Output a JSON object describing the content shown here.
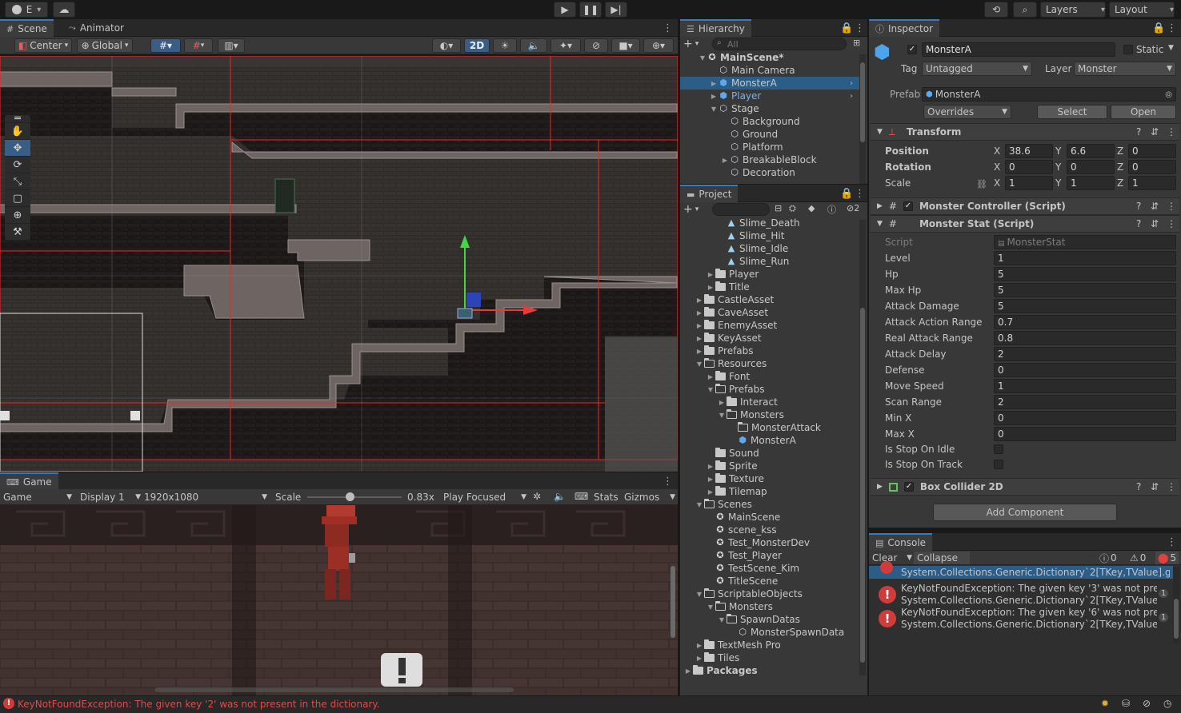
{
  "topbar": {
    "account": "E",
    "layers": "Layers",
    "layout": "Layout"
  },
  "scene": {
    "tabs": [
      {
        "label": "Scene"
      },
      {
        "label": "Animator"
      }
    ],
    "pivot": "Center",
    "space": "Global",
    "mode_2d": "2D"
  },
  "game": {
    "tab": "Game",
    "view": "Game",
    "display": "Display 1",
    "resolution": "1920x1080",
    "scale_label": "Scale",
    "scale_value": "0.83x",
    "scale_fraction": 0.45,
    "play_mode": "Play Focused",
    "stats": "Stats",
    "gizmos": "Gizmos"
  },
  "hierarchy": {
    "tab": "Hierarchy",
    "search_placeholder": "All",
    "rows": [
      {
        "label": "MainScene*",
        "indent": 0,
        "icon": "unity",
        "arrow": "down",
        "bold": true
      },
      {
        "label": "Main Camera",
        "indent": 1,
        "icon": "cube",
        "arrow": ""
      },
      {
        "label": "MonsterA",
        "indent": 1,
        "icon": "cube-blue",
        "arrow": "right",
        "selected": true,
        "chev": true
      },
      {
        "label": "Player",
        "indent": 1,
        "icon": "cube-blue",
        "arrow": "right",
        "color": "#7cb1ef",
        "chev": true
      },
      {
        "label": "Stage",
        "indent": 1,
        "icon": "cube",
        "arrow": "down"
      },
      {
        "label": "Background",
        "indent": 2,
        "icon": "cube",
        "arrow": ""
      },
      {
        "label": "Ground",
        "indent": 2,
        "icon": "cube",
        "arrow": ""
      },
      {
        "label": "Platform",
        "indent": 2,
        "icon": "cube",
        "arrow": ""
      },
      {
        "label": "BreakableBlock",
        "indent": 2,
        "icon": "cube",
        "arrow": "right"
      },
      {
        "label": "Decoration",
        "indent": 2,
        "icon": "cube",
        "arrow": ""
      }
    ]
  },
  "project": {
    "tab": "Project",
    "hidden_count": "2",
    "rows": [
      {
        "label": "Slime_Death",
        "indent": 3,
        "icon": "anim",
        "arrow": ""
      },
      {
        "label": "Slime_Hit",
        "indent": 3,
        "icon": "anim",
        "arrow": ""
      },
      {
        "label": "Slime_Idle",
        "indent": 3,
        "icon": "anim",
        "arrow": ""
      },
      {
        "label": "Slime_Run",
        "indent": 3,
        "icon": "anim",
        "arrow": ""
      },
      {
        "label": "Player",
        "indent": 2,
        "icon": "folder",
        "arrow": "right"
      },
      {
        "label": "Title",
        "indent": 2,
        "icon": "folder",
        "arrow": "right"
      },
      {
        "label": "CastleAsset",
        "indent": 1,
        "icon": "folder",
        "arrow": "right"
      },
      {
        "label": "CaveAsset",
        "indent": 1,
        "icon": "folder",
        "arrow": "right"
      },
      {
        "label": "EnemyAsset",
        "indent": 1,
        "icon": "folder",
        "arrow": "right"
      },
      {
        "label": "KeyAsset",
        "indent": 1,
        "icon": "folder",
        "arrow": "right"
      },
      {
        "label": "Prefabs",
        "indent": 1,
        "icon": "folder",
        "arrow": "right"
      },
      {
        "label": "Resources",
        "indent": 1,
        "icon": "folder-open",
        "arrow": "down"
      },
      {
        "label": "Font",
        "indent": 2,
        "icon": "folder",
        "arrow": "right"
      },
      {
        "label": "Prefabs",
        "indent": 2,
        "icon": "folder-open",
        "arrow": "down"
      },
      {
        "label": "Interact",
        "indent": 3,
        "icon": "folder",
        "arrow": "right"
      },
      {
        "label": "Monsters",
        "indent": 3,
        "icon": "folder-open",
        "arrow": "down"
      },
      {
        "label": "MonsterAttack",
        "indent": 4,
        "icon": "folder-open",
        "arrow": ""
      },
      {
        "label": "MonsterA",
        "indent": 4,
        "icon": "cube-blue",
        "arrow": ""
      },
      {
        "label": "Sound",
        "indent": 2,
        "icon": "folder",
        "arrow": ""
      },
      {
        "label": "Sprite",
        "indent": 2,
        "icon": "folder",
        "arrow": "right"
      },
      {
        "label": "Texture",
        "indent": 2,
        "icon": "folder",
        "arrow": "right"
      },
      {
        "label": "Tilemap",
        "indent": 2,
        "icon": "folder",
        "arrow": "right"
      },
      {
        "label": "Scenes",
        "indent": 1,
        "icon": "folder-open",
        "arrow": "down"
      },
      {
        "label": "MainScene",
        "indent": 2,
        "icon": "unity",
        "arrow": ""
      },
      {
        "label": "scene_kss",
        "indent": 2,
        "icon": "unity",
        "arrow": ""
      },
      {
        "label": "Test_MonsterDev",
        "indent": 2,
        "icon": "unity",
        "arrow": ""
      },
      {
        "label": "Test_Player",
        "indent": 2,
        "icon": "unity",
        "arrow": ""
      },
      {
        "label": "TestScene_Kim",
        "indent": 2,
        "icon": "unity",
        "arrow": ""
      },
      {
        "label": "TitleScene",
        "indent": 2,
        "icon": "unity",
        "arrow": ""
      },
      {
        "label": "ScriptableObjects",
        "indent": 1,
        "icon": "folder-open",
        "arrow": "down"
      },
      {
        "label": "Monsters",
        "indent": 2,
        "icon": "folder-open",
        "arrow": "down"
      },
      {
        "label": "SpawnDatas",
        "indent": 3,
        "icon": "folder-open",
        "arrow": "down"
      },
      {
        "label": "MonsterSpawnData",
        "indent": 4,
        "icon": "so",
        "arrow": ""
      },
      {
        "label": "TextMesh Pro",
        "indent": 1,
        "icon": "folder",
        "arrow": "right"
      },
      {
        "label": "Tiles",
        "indent": 1,
        "icon": "folder",
        "arrow": "right"
      },
      {
        "label": "Packages",
        "indent": 0,
        "icon": "folder",
        "arrow": "right",
        "bold": true
      }
    ]
  },
  "inspector": {
    "tab": "Inspector",
    "name": "MonsterA",
    "static_label": "Static",
    "tag_label": "Tag",
    "tag_value": "Untagged",
    "layer_label": "Layer",
    "layer_value": "Monster",
    "prefab_label": "Prefab",
    "prefab_value": "MonsterA",
    "overrides": "Overrides",
    "select": "Select",
    "open": "Open",
    "transform": {
      "title": "Transform",
      "position_label": "Position",
      "rotation_label": "Rotation",
      "scale_label": "Scale",
      "position": [
        "38.6",
        "6.6",
        "0"
      ],
      "rotation": [
        "0",
        "0",
        "0"
      ],
      "scale": [
        "1",
        "1",
        "1"
      ],
      "axes": [
        "X",
        "Y",
        "Z"
      ]
    },
    "monster_controller": "Monster Controller (Script)",
    "monster_stat": "Monster Stat (Script)",
    "script_label": "Script",
    "script_value": "MonsterStat",
    "stats": [
      {
        "label": "Level",
        "value": "1"
      },
      {
        "label": "Hp",
        "value": "5"
      },
      {
        "label": "Max Hp",
        "value": "5"
      },
      {
        "label": "Attack Damage",
        "value": "5"
      },
      {
        "label": "Attack Action Range",
        "value": "0.7"
      },
      {
        "label": "Real Attack Range",
        "value": "0.8"
      },
      {
        "label": "Attack Delay",
        "value": "2"
      },
      {
        "label": "Defense",
        "value": "0"
      },
      {
        "label": "Move Speed",
        "value": "1"
      },
      {
        "label": "Scan Range",
        "value": "2"
      },
      {
        "label": "Min X",
        "value": "0"
      },
      {
        "label": "Max X",
        "value": "0"
      }
    ],
    "is_stop_on_idle": "Is Stop On Idle",
    "is_stop_on_track": "Is Stop On Track",
    "box_collider": "Box Collider 2D",
    "add_component": "Add Component"
  },
  "console": {
    "tab": "Console",
    "clear": "Clear",
    "collapse": "Collapse",
    "info_count": "0",
    "warn_count": "0",
    "error_count": "5",
    "partial_line": "System.Collections.Generic.Dictionary`2[TKey,TValue].get_",
    "messages": [
      {
        "line1": "KeyNotFoundException: The given key '3' was not present in",
        "line2": "System.Collections.Generic.Dictionary`2[TKey,TValue].get_",
        "count": "1"
      },
      {
        "line1": "KeyNotFoundException: The given key '6' was not present in",
        "line2": "System.Collections.Generic.Dictionary`2[TKey,TValue].get_",
        "count": "1"
      }
    ]
  },
  "status": {
    "message": "KeyNotFoundException: The given key '2' was not present in the dictionary."
  }
}
